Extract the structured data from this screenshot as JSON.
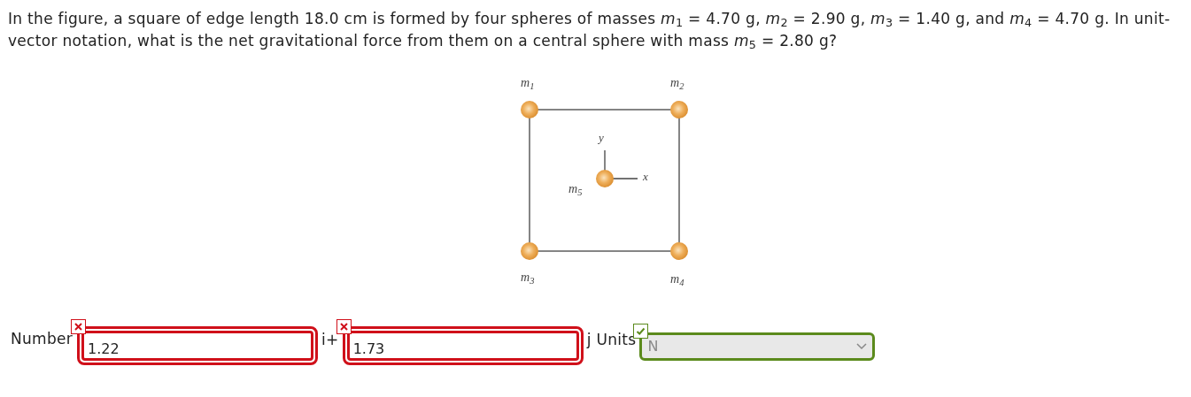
{
  "question": "In the figure, a square of edge length 18.0 cm is formed by four spheres of masses *m*$_{1}$ = 4.70 g, *m*$_{2}$ = 2.90 g, *m*$_{3}$ = 1.40 g, and *m*$_{4}$ = 4.70 g. In unit-vector notation, what is the net gravitational force from them on a central sphere with mass *m*$_{5}$ = 2.80 g?",
  "figure": {
    "labels": [
      {
        "kind": "mass",
        "text": "m$_{1}$"
      },
      {
        "kind": "mass",
        "text": "m$_{2}$"
      },
      {
        "kind": "mass",
        "text": "m$_{3}$"
      },
      {
        "kind": "mass",
        "text": "m$_{4}$"
      },
      {
        "kind": "mass",
        "text": "m$_{5}$"
      },
      {
        "kind": "axis",
        "text": "y"
      },
      {
        "kind": "axis",
        "text": "x"
      }
    ]
  },
  "answer": {
    "label": "Number",
    "fields": [
      {
        "value": "1.22",
        "correct": false,
        "suffix": "i+"
      },
      {
        "value": "1.73",
        "correct": false,
        "suffix": "j Units"
      }
    ],
    "units": {
      "value": "N",
      "correct": true,
      "disabled": true
    }
  }
}
